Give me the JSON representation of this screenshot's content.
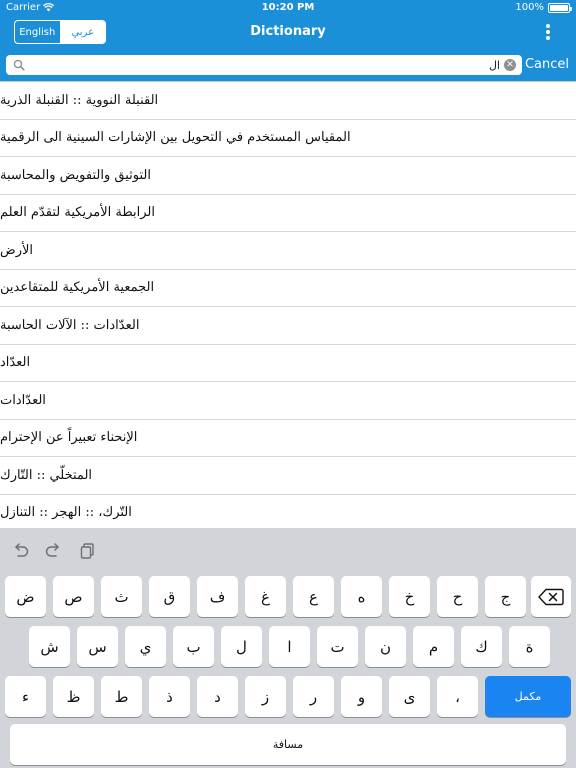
{
  "status_bar": {
    "carrier": "Carrier",
    "time": "10:20 PM",
    "battery": "100%"
  },
  "nav": {
    "title": "Dictionary",
    "lang_english": "English",
    "lang_arabic": "عربي",
    "selected_language": "عربي"
  },
  "search": {
    "value": "ال",
    "placeholder": "",
    "cancel_label": "Cancel"
  },
  "results": [
    "القنبلة النووية :: القنبلة الذرية",
    "المقياس المستخدم في التحويل بين الإشارات السينية الى الرقمية",
    "التوثيق والتفويض والمحاسبة",
    "الرابطة الأمريكية لتقدّم العلم",
    "الأرض",
    "الجمعية الأمريكية للمتقاعدين",
    "العدّادات :: الآلات الحاسبة",
    "العدّاد",
    "العدّادات",
    "الإنحناء تعبيراً عن الإحترام",
    "المتخلّي :: التّارك",
    "التّرك، :: الهجر :: التنازل"
  ],
  "keyboard": {
    "row1": [
      "ض",
      "ص",
      "ث",
      "ق",
      "ف",
      "غ",
      "ع",
      "ه",
      "خ",
      "ح",
      "ج"
    ],
    "row2": [
      "ش",
      "س",
      "ي",
      "ب",
      "ل",
      "ا",
      "ت",
      "ن",
      "م",
      "ك",
      "ة"
    ],
    "row3": [
      "ء",
      "ظ",
      "ط",
      "ذ",
      "د",
      "ز",
      "ر",
      "و",
      "ى",
      "،"
    ],
    "return_label": "مكمل",
    "space_label": "مسافة"
  },
  "colors": {
    "accent": "#1b8fd8",
    "keyboard_bg": "#d1d4d9",
    "return_key": "#1a84f0"
  }
}
